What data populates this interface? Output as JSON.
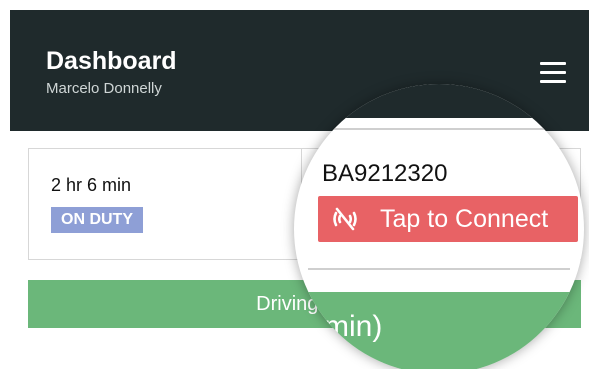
{
  "header": {
    "title": "Dashboard",
    "subtitle": "Marcelo Donnelly",
    "menu_icon": "hamburger-menu-icon"
  },
  "status_card": {
    "duty_time": "2 hr 6 min",
    "duty_status": "ON DUTY",
    "device_id": "BA9212320",
    "connect_label": "Tap to Connect",
    "connect_icon": "link-broken-icon"
  },
  "driving_bar": {
    "label_partial": "Driving (05",
    "magnified_partial": "min)"
  },
  "colors": {
    "header_bg": "#1f2a2c",
    "duty_badge": "#8e9fd6",
    "connect_button": "#e86265",
    "driving_bar": "#6bb77a"
  }
}
